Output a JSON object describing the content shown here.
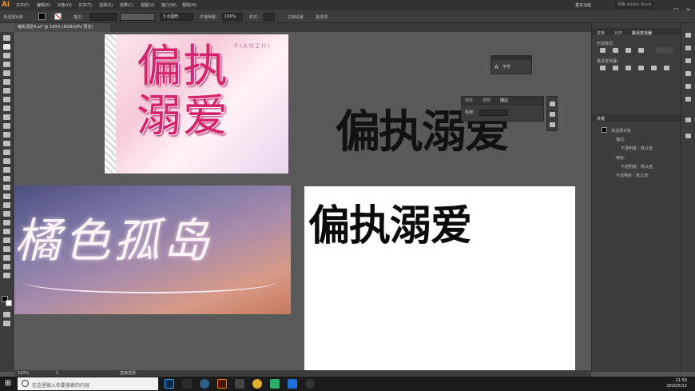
{
  "app": {
    "logo": "Ai",
    "menus": [
      "文件(F)",
      "编辑(E)",
      "对象(O)",
      "文字(T)",
      "选择(S)",
      "效果(C)",
      "视图(V)",
      "窗口(W)",
      "帮助(H)"
    ],
    "workspace": "基本功能",
    "search_placeholder": "搜索 Adobe Stock"
  },
  "controlbar": {
    "selection_label": "未选择对象",
    "stroke_label": "描边：",
    "stroke_value": "",
    "brush": "3 点圆形",
    "opacity_label": "不透明度：",
    "opacity_value": "100%",
    "style_label": "样式：",
    "doc_setup": "文档设置",
    "prefs": "首选项"
  },
  "document": {
    "tab": "偏执溺爱4.ai* @ 100% (RGB/GPU 预览)",
    "zoom": "100%",
    "page": "1",
    "status": "直接选择"
  },
  "artwork": {
    "art1_title": "偏执溺爱",
    "art1_sub": "PIANZHI",
    "art2_title": "橘色孤岛",
    "plain_text": "偏执溺爱",
    "board_text": "偏执溺爱"
  },
  "floating": {
    "char_label": "字符",
    "stroke_tabs": [
      "渐变",
      "透明",
      "描边"
    ],
    "weight_label": "粗细："
  },
  "rightpanel": {
    "tabs": [
      "变换",
      "对齐",
      "路径查找器"
    ],
    "shape_modes": "形状模式：",
    "pathfinder_label": "路径查找器：",
    "appearance_title": "外观",
    "appearance_rows": [
      "未选择对象",
      "描边：",
      "不透明度：默认值",
      "填色：",
      "不透明度：默认值",
      "不透明度：默认值"
    ]
  },
  "taskbar": {
    "search": "在这里输入你要搜索的内容",
    "time": "21:50",
    "date": "2020/5/12"
  }
}
